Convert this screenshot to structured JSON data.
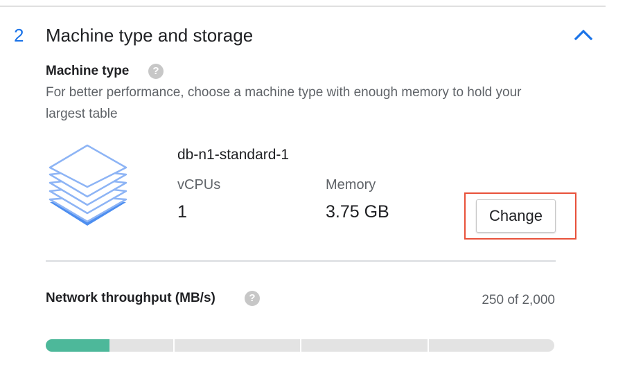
{
  "section": {
    "step_number": "2",
    "title": "Machine type and storage",
    "collapse_icon": "chevron-up-icon",
    "accent_color": "#1a73e8"
  },
  "machine_type": {
    "label": "Machine type",
    "help_icon": "?",
    "description": "For better performance, choose a machine type with enough memory to hold your largest table",
    "name": "db-n1-standard-1",
    "vcpus_label": "vCPUs",
    "vcpus_value": "1",
    "memory_label": "Memory",
    "memory_value": "3.75 GB",
    "change_label": "Change",
    "icon": "layered-stack-icon"
  },
  "network": {
    "label": "Network throughput (MB/s)",
    "help_icon": "?",
    "value_text": "250 of 2,000",
    "current": 250,
    "max": 2000,
    "segments": 4,
    "fill_color": "#4db89a"
  }
}
